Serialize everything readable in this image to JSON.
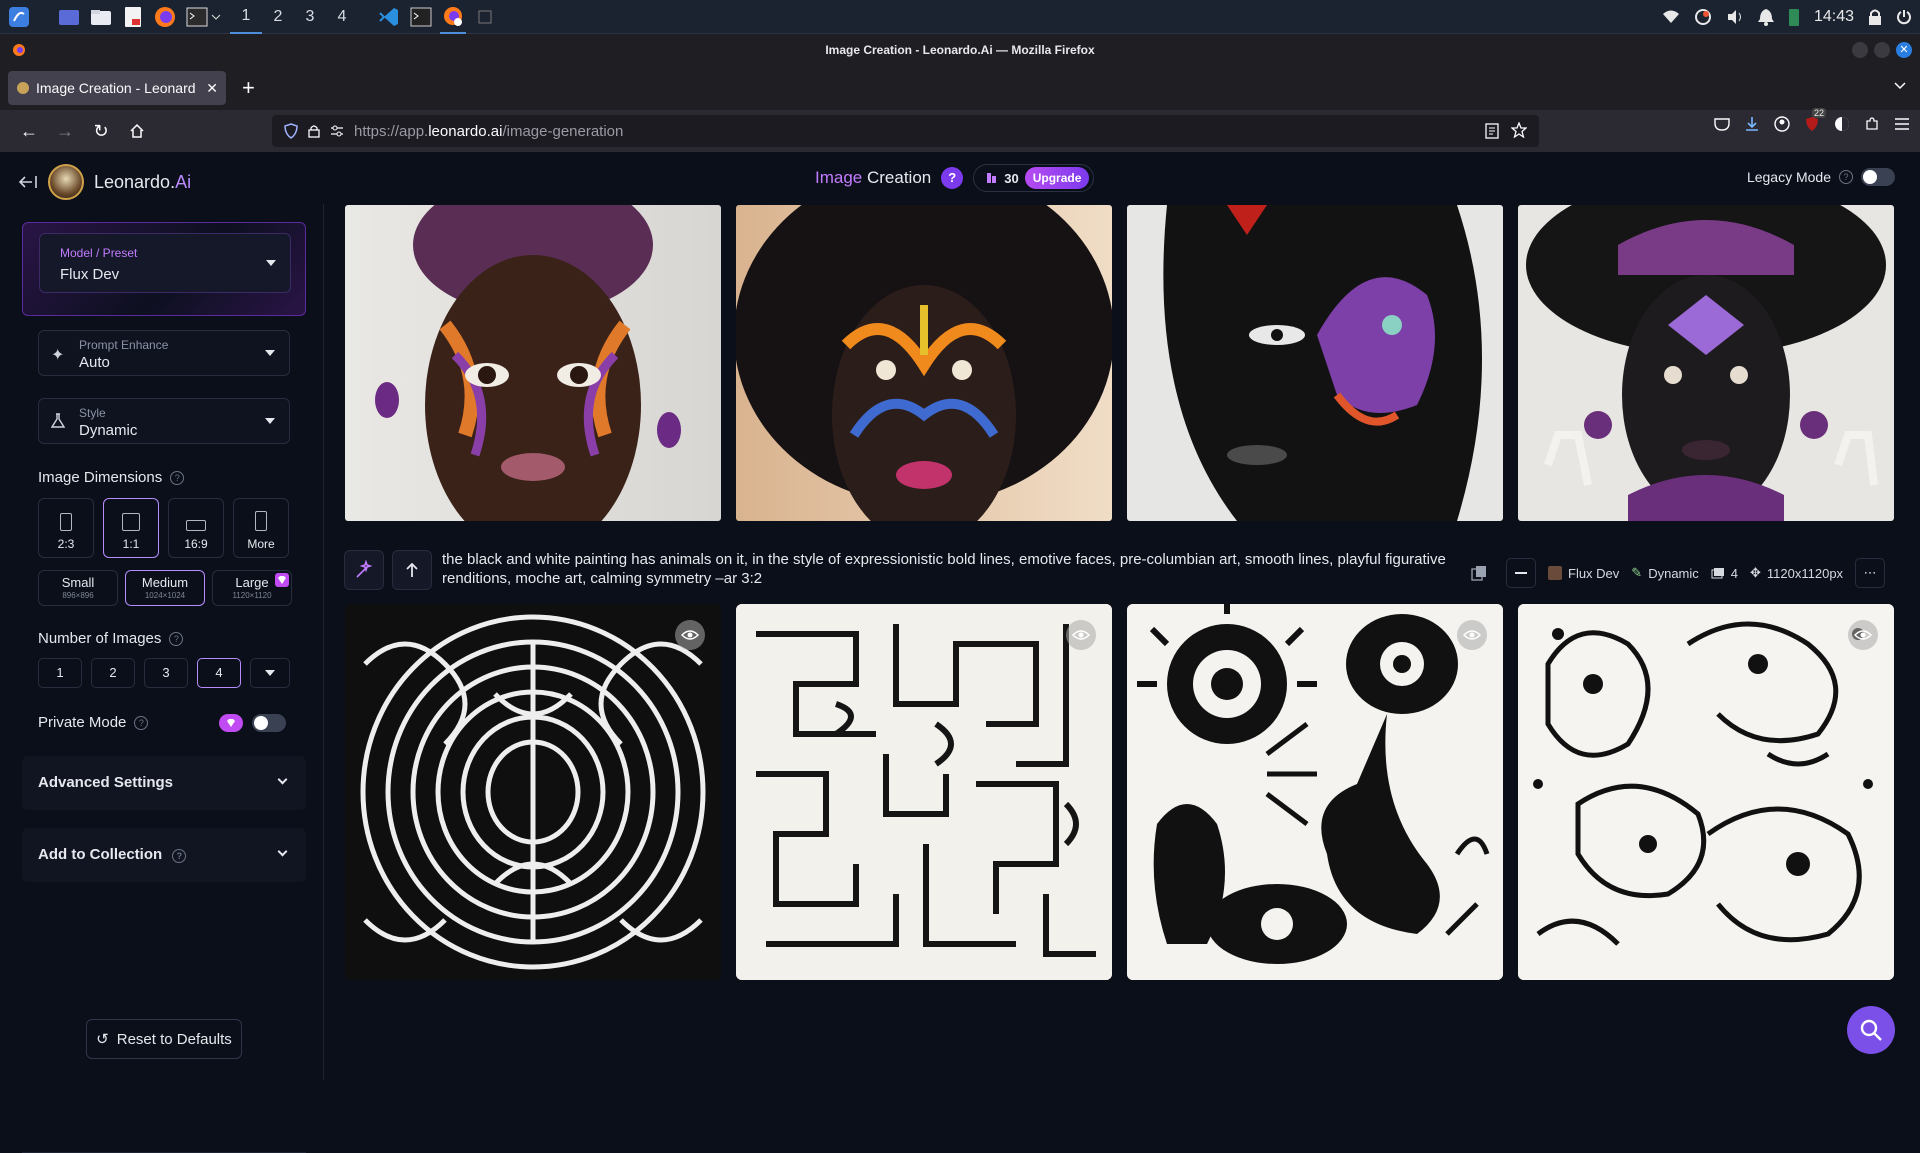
{
  "os": {
    "workspaces": [
      "1",
      "2",
      "3",
      "4"
    ],
    "clock": "14:43"
  },
  "browser": {
    "window_title": "Image Creation - Leonardo.Ai — Mozilla Firefox",
    "tab_title": "Image Creation - Leonard",
    "url_prefix": "https://app.",
    "url_host": "leonardo.ai",
    "url_path": "/image-generation",
    "ext_badge": "22"
  },
  "header": {
    "brand_main": "Leonardo.",
    "brand_accent": "Ai",
    "title_accent": "Image",
    "title_main": "Creation",
    "help": "?",
    "credits": "30",
    "upgrade": "Upgrade",
    "legacy_mode": "Legacy Mode"
  },
  "sidebar": {
    "model_label": "Model / Preset",
    "model_value": "Flux Dev",
    "prompt_enhance_label": "Prompt Enhance",
    "prompt_enhance_value": "Auto",
    "style_label": "Style",
    "style_value": "Dynamic",
    "image_dimensions": "Image Dimensions",
    "dims": [
      "2:3",
      "1:1",
      "16:9",
      "More"
    ],
    "sizes": [
      {
        "label": "Small",
        "sub": "896×896"
      },
      {
        "label": "Medium",
        "sub": "1024×1024"
      },
      {
        "label": "Large",
        "sub": "1120×1120"
      }
    ],
    "number_of_images": "Number of Images",
    "numbers": [
      "1",
      "2",
      "3",
      "4"
    ],
    "private_mode": "Private Mode",
    "advanced_settings": "Advanced Settings",
    "add_to_collection": "Add to Collection",
    "reset": "Reset to Defaults"
  },
  "generation": {
    "prompt": "the black and white painting has animals on it, in the style of expressionistic bold lines, emotive faces, pre-columbian art, smooth lines, playful figurative renditions, moche art, calming symmetry –ar 3:2",
    "model": "Flux Dev",
    "style": "Dynamic",
    "count": "4",
    "size": "1120x1120px"
  },
  "colors": {
    "accent": "#b889ff",
    "brand_purple": "#7c3aed",
    "background": "#0b0f19"
  }
}
